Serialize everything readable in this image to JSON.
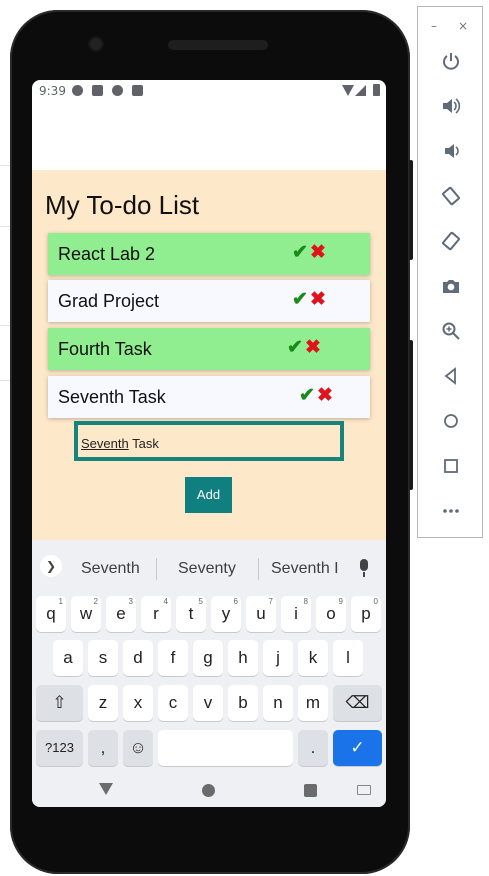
{
  "status_bar": {
    "time": "9:39"
  },
  "app": {
    "title": "My To-do List",
    "tasks": [
      {
        "label": "React Lab 2",
        "status": "done"
      },
      {
        "label": "Grad Project",
        "status": "open"
      },
      {
        "label": "Fourth Task",
        "status": "done"
      },
      {
        "label": "Seventh Task",
        "status": "open"
      }
    ],
    "input": {
      "value_word1": "Seventh",
      "value_word2": "Task"
    },
    "add_label": "Add",
    "colors": {
      "done_bg": "#90ee90",
      "open_bg": "#f8f8ff",
      "page_bg": "#fde8c9",
      "accent": "#0f7f80"
    }
  },
  "keyboard": {
    "suggestions": [
      "Seventh",
      "Seventy",
      "Seventh I"
    ],
    "row1": [
      "q",
      "w",
      "e",
      "r",
      "t",
      "y",
      "u",
      "i",
      "o",
      "p"
    ],
    "row1_hints": [
      "1",
      "2",
      "3",
      "4",
      "5",
      "6",
      "7",
      "8",
      "9",
      "0"
    ],
    "row2": [
      "a",
      "s",
      "d",
      "f",
      "g",
      "h",
      "j",
      "k",
      "l"
    ],
    "row3": [
      "z",
      "x",
      "c",
      "v",
      "b",
      "n",
      "m"
    ],
    "symbols_label": "?123",
    "comma": ",",
    "period": ".",
    "emoji": "☺",
    "enter": "✓",
    "shift": "⇧",
    "backspace": "⌫"
  },
  "emulator_panel": {
    "minimize": "–",
    "close": "×",
    "buttons": [
      "power-icon",
      "volume-up-icon",
      "volume-down-icon",
      "rotate-left-icon",
      "rotate-right-icon",
      "camera-icon",
      "zoom-icon",
      "back-icon",
      "home-icon",
      "overview-icon",
      "more-icon"
    ]
  }
}
